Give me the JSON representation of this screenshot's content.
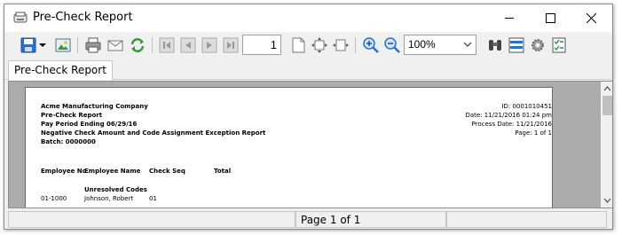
{
  "window": {
    "title": "Pre-Check Report",
    "controls": {
      "minimize_icon": "minimize-icon",
      "maximize_icon": "maximize-icon",
      "close_icon": "close-icon"
    }
  },
  "toolbar": {
    "current_page": "1",
    "zoom": "100%",
    "icons": [
      "save-icon",
      "dropdown-arrow-icon",
      "export-image-icon",
      "print-icon",
      "email-icon",
      "refresh-icon",
      "first-page-icon",
      "previous-page-icon",
      "next-page-icon",
      "last-page-icon",
      "page-view-icon",
      "fit-page-icon",
      "fit-width-icon",
      "zoom-in-icon",
      "zoom-out-icon",
      "find-icon",
      "group-tree-icon",
      "settings-icon",
      "checklist-icon"
    ]
  },
  "tabs": [
    {
      "label": "Pre-Check Report"
    }
  ],
  "report": {
    "company": "Acme Manufacturing Company",
    "report_name": "Pre-Check Report",
    "pay_period": "Pay Period Ending 06/29/16",
    "description": "Negative Check Amount and Code Assignment Exception Report",
    "batch": "Batch: 0000000",
    "id": "ID: 0001010451",
    "date": "Date: 11/21/2016 01:24 pm",
    "process_date": "Process Date: 11/21/2016",
    "page_info": "Page: 1 of 1",
    "columns": [
      "Employee No",
      "Employee Name",
      "Check Seq",
      "Total"
    ],
    "section_heading": "Unresolved Codes",
    "rows": [
      {
        "employee_no": "01-1000",
        "employee_name": "Johnson, Robert",
        "check_seq": "01"
      }
    ]
  },
  "status": {
    "page_label": "Page 1 of 1"
  },
  "colors": {
    "accent_blue": "#2a6fc9",
    "viewport_gray": "#ababab",
    "refresh_green": "#3a9a3a"
  }
}
